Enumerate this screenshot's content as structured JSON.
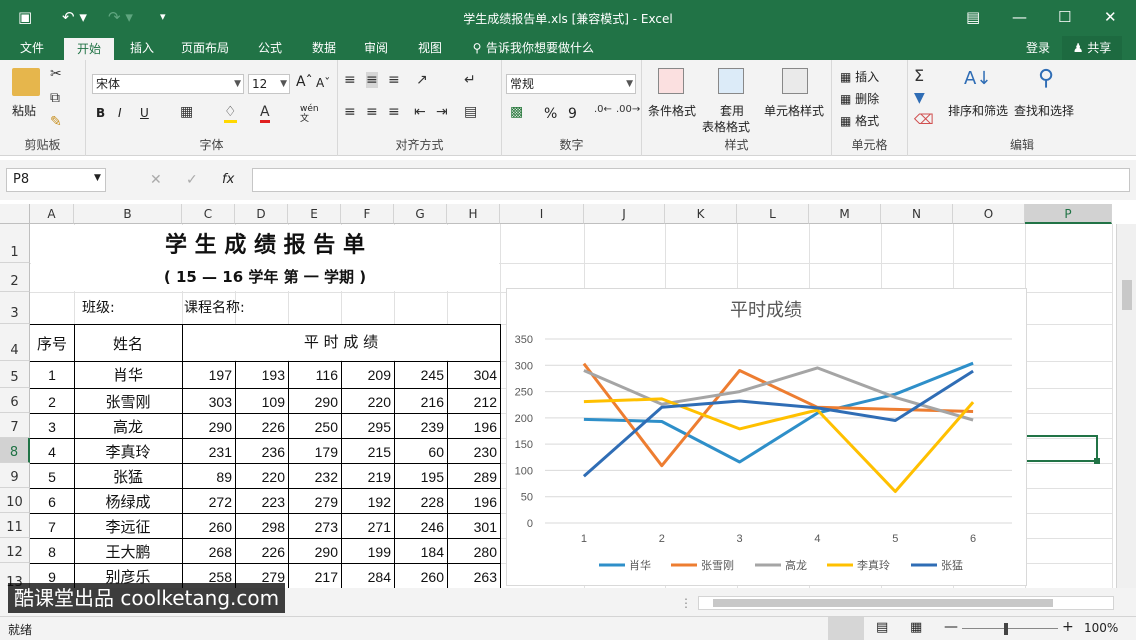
{
  "window": {
    "title": "学生成绩报告单.xls  [兼容模式] - Excel",
    "save_icon": "save-icon",
    "undo_icon": "undo-icon"
  },
  "menu": {
    "tabs": [
      "文件",
      "开始",
      "插入",
      "页面布局",
      "公式",
      "数据",
      "审阅",
      "视图"
    ],
    "active_tab": "开始",
    "tell_me": "告诉我你想要做什么",
    "login": "登录",
    "share": "共享"
  },
  "ribbon": {
    "clipboard": {
      "paste": "粘贴",
      "label": "剪贴板"
    },
    "font": {
      "name": "宋体",
      "size": "12",
      "bold": "B",
      "italic": "I",
      "underline": "U",
      "label": "字体",
      "wen": "wén\n文"
    },
    "alignment": {
      "label": "对齐方式"
    },
    "number": {
      "format": "常规",
      "percent": "%",
      "comma": "9",
      "label": "数字"
    },
    "styles": {
      "conditional": "条件格式",
      "table_1": "套用",
      "table_2": "表格格式",
      "cell_styles": "单元格样式",
      "label": "样式"
    },
    "cells": {
      "insert": "插入",
      "delete": "删除",
      "format": "格式",
      "label": "单元格"
    },
    "editing": {
      "sort": "排序和筛选",
      "find": "查找和选择",
      "label": "编辑"
    }
  },
  "formula_bar": {
    "name_box": "P8",
    "formula": ""
  },
  "columns": [
    "A",
    "B",
    "C",
    "D",
    "E",
    "F",
    "G",
    "H",
    "I",
    "J",
    "K",
    "L",
    "M",
    "N",
    "O",
    "P"
  ],
  "rows": [
    "1",
    "2",
    "3",
    "4",
    "5",
    "6",
    "7",
    "8",
    "9",
    "10",
    "11",
    "12",
    "13"
  ],
  "sheet": {
    "title": "学 生 成 绩 报 告 单",
    "subtitle": "( 15 — 16    学年 第 一 学期 )",
    "class_label": "班级:",
    "course_label": "课程名称:",
    "seq_header": "序号",
    "name_header": "姓名",
    "scores_header": "平 时 成 绩",
    "students": [
      {
        "no": "1",
        "name": "肖华",
        "scores": [
          "197",
          "193",
          "116",
          "209",
          "245",
          "304"
        ]
      },
      {
        "no": "2",
        "name": "张雪刚",
        "scores": [
          "303",
          "109",
          "290",
          "220",
          "216",
          "212"
        ]
      },
      {
        "no": "3",
        "name": "高龙",
        "scores": [
          "290",
          "226",
          "250",
          "295",
          "239",
          "196"
        ]
      },
      {
        "no": "4",
        "name": "李真玲",
        "scores": [
          "231",
          "236",
          "179",
          "215",
          "60",
          "230"
        ]
      },
      {
        "no": "5",
        "name": "张猛",
        "scores": [
          "89",
          "220",
          "232",
          "219",
          "195",
          "289"
        ]
      },
      {
        "no": "6",
        "name": "杨绿成",
        "scores": [
          "272",
          "223",
          "279",
          "192",
          "228",
          "196"
        ]
      },
      {
        "no": "7",
        "name": "李远征",
        "scores": [
          "260",
          "298",
          "273",
          "271",
          "246",
          "301"
        ]
      },
      {
        "no": "8",
        "name": "王大鹏",
        "scores": [
          "268",
          "226",
          "290",
          "199",
          "184",
          "280"
        ]
      },
      {
        "no": "9",
        "name": "别彦乐",
        "scores": [
          "258",
          "279",
          "217",
          "284",
          "260",
          "263"
        ]
      }
    ]
  },
  "chart_data": {
    "type": "line",
    "title": "平时成绩",
    "x": [
      1,
      2,
      3,
      4,
      5,
      6
    ],
    "ylim": [
      0,
      350
    ],
    "yticks": [
      0,
      50,
      100,
      150,
      200,
      250,
      300,
      350
    ],
    "grid": true,
    "legend": "bottom",
    "series": [
      {
        "name": "肖华",
        "color": "#2e8fc9",
        "values": [
          197,
          193,
          116,
          209,
          245,
          304
        ]
      },
      {
        "name": "张雪刚",
        "color": "#ed7d31",
        "values": [
          303,
          109,
          290,
          220,
          216,
          212
        ]
      },
      {
        "name": "高龙",
        "color": "#a5a5a5",
        "values": [
          290,
          226,
          250,
          295,
          239,
          196
        ]
      },
      {
        "name": "李真玲",
        "color": "#ffc000",
        "values": [
          231,
          236,
          179,
          215,
          60,
          230
        ]
      },
      {
        "name": "张猛",
        "color": "#2f6db5",
        "values": [
          89,
          220,
          232,
          219,
          195,
          289
        ]
      }
    ]
  },
  "status": {
    "ready": "就绪",
    "zoom": "100%"
  },
  "watermark": "酷课堂出品 coolketang.com"
}
